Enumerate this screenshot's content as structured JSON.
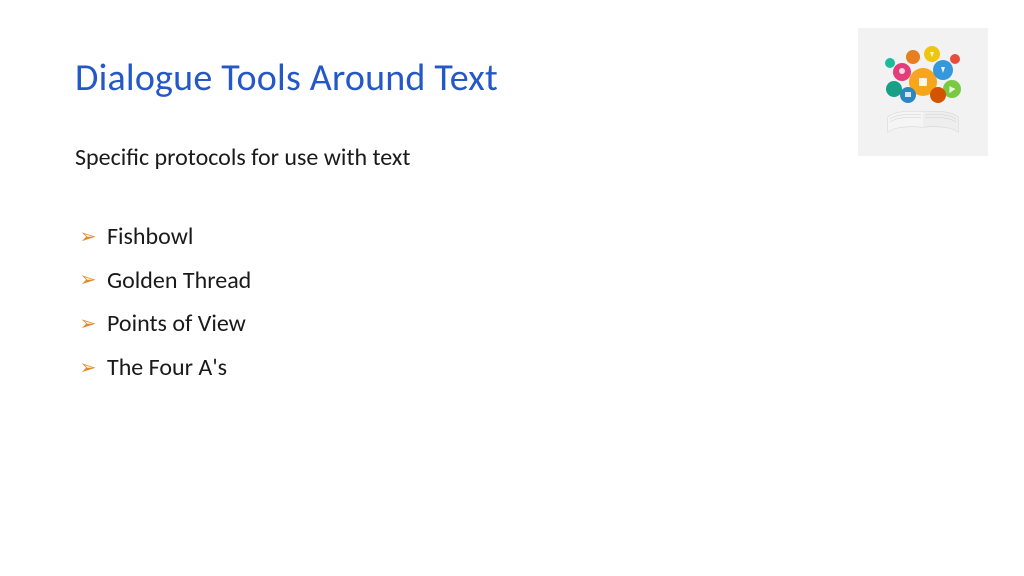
{
  "title": "Dialogue Tools Around Text",
  "subtitle": "Specific protocols for use with text",
  "bullets": [
    "Fishbowl",
    "Golden Thread",
    "Points of View",
    "The Four A's"
  ],
  "bullet_symbol": "➢",
  "image_alt": "Open book with colorful subject icons"
}
